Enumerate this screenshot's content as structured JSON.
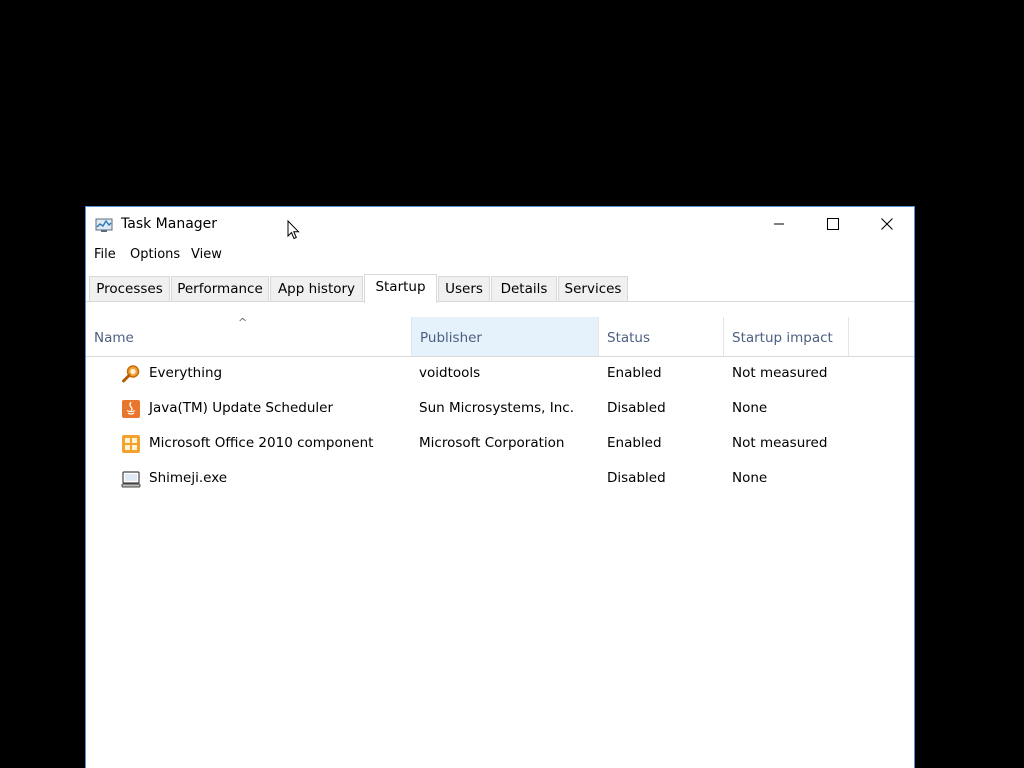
{
  "window": {
    "title": "Task Manager"
  },
  "menu": [
    "File",
    "Options",
    "View"
  ],
  "tabs": [
    {
      "label": "Processes",
      "active": false
    },
    {
      "label": "Performance",
      "active": false
    },
    {
      "label": "App history",
      "active": false
    },
    {
      "label": "Startup",
      "active": true
    },
    {
      "label": "Users",
      "active": false
    },
    {
      "label": "Details",
      "active": false
    },
    {
      "label": "Services",
      "active": false
    }
  ],
  "table": {
    "sort_indicator": "^",
    "columns": [
      "Name",
      "Publisher",
      "Status",
      "Startup impact"
    ],
    "rows": [
      {
        "icon": "magnifier-icon",
        "name": "Everything",
        "publisher": "voidtools",
        "status": "Enabled",
        "impact": "Not measured"
      },
      {
        "icon": "java-icon",
        "name": "Java(TM) Update Scheduler",
        "publisher": "Sun Microsystems, Inc.",
        "status": "Disabled",
        "impact": "None"
      },
      {
        "icon": "office-icon",
        "name": "Microsoft Office 2010 component",
        "publisher": "Microsoft Corporation",
        "status": "Enabled",
        "impact": "Not measured"
      },
      {
        "icon": "program-icon",
        "name": "Shimeji.exe",
        "publisher": "",
        "status": "Disabled",
        "impact": "None"
      }
    ]
  },
  "colors": {
    "desktop": "#000000",
    "window_border": "#5a8fd6",
    "header_text": "#4d6082",
    "header_hover": "#e5f1fb"
  }
}
